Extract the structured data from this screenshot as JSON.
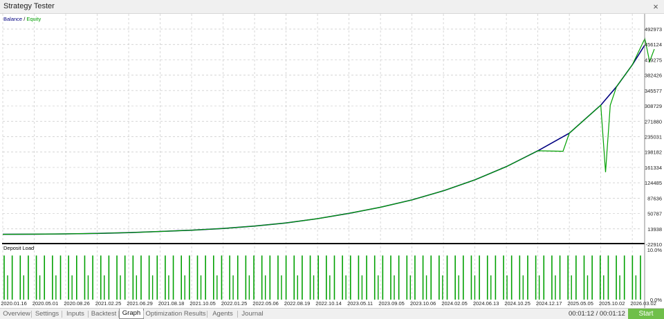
{
  "window": {
    "title": "Strategy Tester",
    "close_icon": "×"
  },
  "tabs": [
    "Overview",
    "Settings",
    "Inputs",
    "Backtest",
    "Graph",
    "Optimization Results",
    "Agents",
    "Journal"
  ],
  "active_tab": "Graph",
  "timer": "00:01:12 / 00:01:12",
  "start_label": "Start",
  "colors": {
    "balance": "#000080",
    "equity": "#00a000",
    "load": "#00a000",
    "grid": "#c8c8c8"
  },
  "chart_data": [
    {
      "type": "line",
      "legend": {
        "balance": "Balance",
        "sep": " / ",
        "equity": "Equity"
      },
      "legend_position": "top-left",
      "grid": true,
      "y_ticks": [
        -22910,
        13938,
        50787,
        87636,
        124485,
        161334,
        198182,
        235031,
        271880,
        308729,
        345577,
        382426,
        419275,
        456124,
        492973
      ],
      "ylim": [
        -22910,
        492973
      ],
      "x_ticks": [
        "2020.01.16",
        "2020.05.01",
        "2020.08.26",
        "2021.02.25",
        "2021.06.29",
        "2021.08.18",
        "2021.10.05",
        "2022.01.25",
        "2022.05.06",
        "2022.08.19",
        "2022.10.14",
        "2023.05.11",
        "2023.09.05",
        "2023.10.06",
        "2024.02.05",
        "2024.06.13",
        "2024.10.25",
        "2024.12.17",
        "2025.05.05",
        "2025.10.02",
        "2026.03.02"
      ],
      "series": [
        {
          "name": "Balance",
          "x": [
            0,
            1,
            2,
            3,
            4,
            5,
            6,
            7,
            8,
            9,
            10,
            11,
            12,
            13,
            14,
            15,
            16,
            17,
            18,
            19,
            19.5,
            20,
            20.4
          ],
          "y": [
            1000,
            1300,
            2000,
            3200,
            5000,
            7700,
            10700,
            14900,
            20700,
            28100,
            38400,
            51300,
            65800,
            83400,
            105300,
            131500,
            163200,
            201200,
            243300,
            310500,
            355000,
            407000,
            455000
          ]
        },
        {
          "name": "Equity",
          "x": [
            0,
            1,
            2,
            3,
            4,
            5,
            6,
            7,
            8,
            9,
            10,
            11,
            12,
            13,
            14,
            15,
            16,
            17,
            17.8,
            18,
            19,
            19.15,
            19.3,
            19.5,
            20,
            20.4,
            20.55,
            20.7
          ],
          "y": [
            1000,
            1300,
            2000,
            3200,
            5000,
            7700,
            10700,
            14900,
            20700,
            28100,
            38400,
            51300,
            65800,
            83400,
            105300,
            131500,
            163200,
            201200,
            200000,
            243300,
            310500,
            150000,
            310500,
            355000,
            407000,
            470000,
            415000,
            445000
          ]
        }
      ]
    },
    {
      "type": "bar",
      "title": "Deposit Load",
      "y_ticks": [
        "10.0%",
        "0.0%"
      ],
      "ylim": [
        0,
        10
      ],
      "values": [
        8.5,
        8.5,
        8.5,
        8.5,
        8.5,
        8.5,
        8.5,
        8.5,
        8.5,
        8.5,
        8.5,
        8.5,
        8.5,
        8.5,
        8.5,
        8.5,
        8.5,
        8.5,
        8.5,
        8.5,
        8.5,
        8.5,
        8.5,
        8.5,
        8.5,
        8.5,
        8.5,
        8.5,
        8.5,
        8.5,
        8.5,
        8.5,
        8.5,
        8.5,
        8.5,
        8.5,
        8.5,
        8.5,
        8.5,
        8.5,
        8.5,
        8.5,
        8.5,
        8.5,
        8.5,
        8.5,
        8.5,
        8.5,
        8.5,
        8.5,
        8.5,
        8.5,
        8.5,
        8.5,
        8.5,
        8.5,
        8.5,
        8.5,
        8.5,
        8.5,
        8.5,
        8.5,
        8.5,
        8.5,
        8.5,
        8.5,
        8.5,
        8.5,
        8.5,
        8.5,
        8.5,
        8.5,
        8.5,
        8.5,
        8.5,
        8.5,
        8.5,
        8.5,
        8.5,
        8.5
      ]
    }
  ]
}
